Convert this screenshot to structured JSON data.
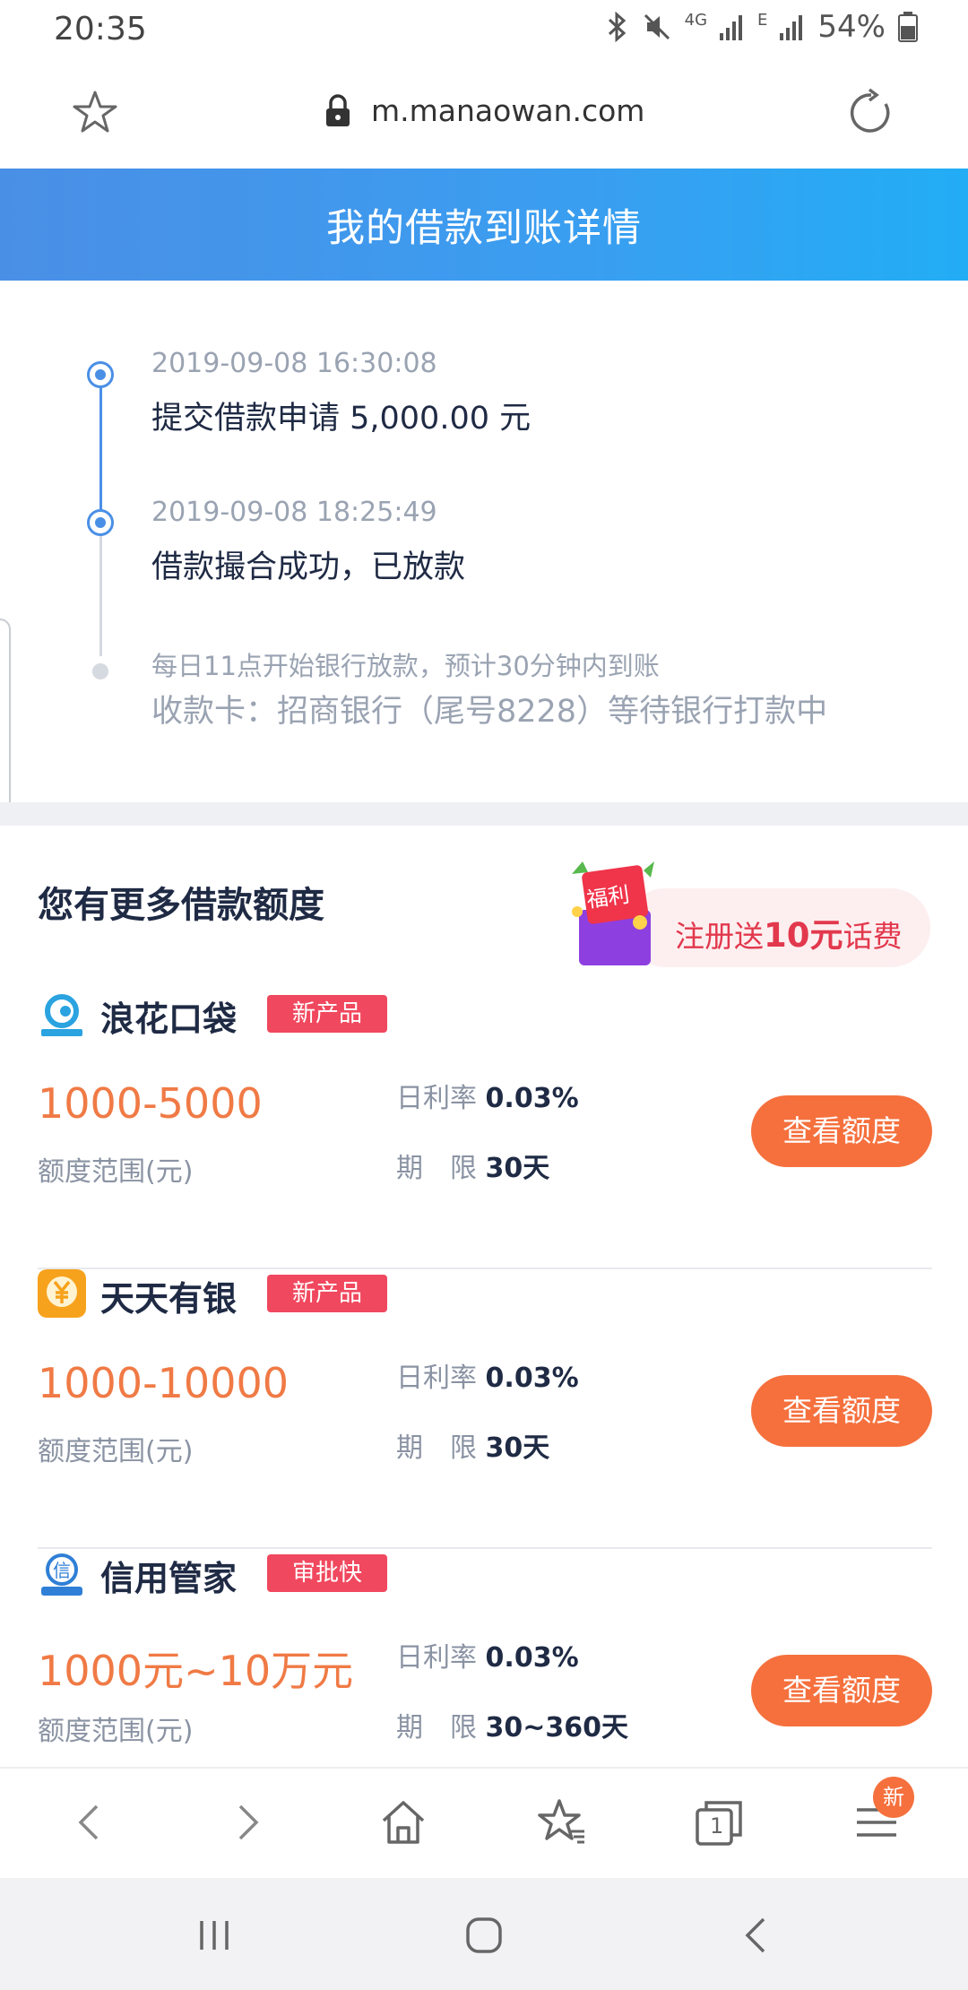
{
  "status_bar": {
    "time": "20:35",
    "network": "4G",
    "network2": "E",
    "battery": "54%"
  },
  "browser": {
    "url": "m.manaowan.com",
    "icons": [
      "star-icon",
      "lock-icon",
      "reload-icon"
    ]
  },
  "header": {
    "title": "我的借款到账详情"
  },
  "timeline": {
    "events": [
      {
        "time": "2019-09-08 16:30:08",
        "desc": "提交借款申请 5,000.00 元"
      },
      {
        "time": "2019-09-08 18:25:49",
        "desc": "借款撮合成功，已放款"
      }
    ],
    "pending_note": "每日11点开始银行放款，预计30分钟内到账",
    "pending_card": "收款卡：招商银行（尾号8228）等待银行打款中"
  },
  "more": {
    "title": "您有更多借款额度",
    "promo": {
      "bag_label": "福利",
      "text_before": "注册送",
      "text_amount": "10元",
      "text_after": "话费"
    },
    "products": [
      {
        "name": "浪花口袋",
        "tag": "新产品",
        "range": "1000-5000",
        "range_label": "额度范围(元)",
        "rate_label": "日利率",
        "rate": "0.03%",
        "term_label": "期　限",
        "term": "30天",
        "button": "查看额度",
        "logo_color": "#2aa3e0"
      },
      {
        "name": "天天有银",
        "tag": "新产品",
        "range": "1000-10000",
        "range_label": "额度范围(元)",
        "rate_label": "日利率",
        "rate": "0.03%",
        "term_label": "期　限",
        "term": "30天",
        "button": "查看额度",
        "logo_color": "#f7a21c"
      },
      {
        "name": "信用管家",
        "tag": "审批快",
        "range": "1000元~10万元",
        "range_label": "额度范围(元)",
        "rate_label": "日利率",
        "rate": "0.03%",
        "term_label": "期　限",
        "term": "30~360天",
        "button": "查看额度",
        "logo_color": "#2f7fd6"
      }
    ]
  },
  "browser_toolbar": {
    "tabs_count": "1",
    "menu_badge": "新"
  },
  "colors": {
    "accent_blue": "#4a8fe6",
    "orange": "#f5703d",
    "tag_red": "#f0485e"
  }
}
